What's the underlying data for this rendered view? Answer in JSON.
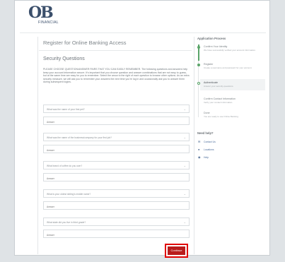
{
  "brand": {
    "logo_mark": "OB",
    "logo_sub": "FINANCIAL"
  },
  "page": {
    "title": "Register for Online Banking Access"
  },
  "section": {
    "heading": "Security Questions",
    "instructions": "PLEASE CHOOSE QUESTION/ANSWER PAIRS THAT YOU CAN EASILY REMEMBER. The following questions and answers help keep your account information secure. It's important that you choose question and answer combinations that are not easy to guess, but at the same time are easy for you to remember. Select the arrow to the right of each question to browse other options. As an extra security measure, we will ask you to remember your answers the next time you're log in and occasionally ask you to answer them during subsequent logins."
  },
  "questions": [
    {
      "question": "What was the name of your first pet?",
      "placeholder": "Answer"
    },
    {
      "question": "What was the name of the business/company for your first job?",
      "placeholder": "Answer"
    },
    {
      "question": "What brand of coffee do you own?",
      "placeholder": "Answer"
    },
    {
      "question": "What is your oldest sibling's middle name?",
      "placeholder": "Answer"
    },
    {
      "question": "What state did you live in third grade?",
      "placeholder": "Answer"
    }
  ],
  "continue_label": "Continue",
  "sidebar": {
    "title": "Application Process",
    "steps": [
      {
        "title": "Confirm Your Identity",
        "desc": "We have successfully verified your account information."
      },
      {
        "title": "Register",
        "desc": "Create a username and password for your account."
      },
      {
        "title": "Authenticate",
        "desc": "Answer your security questions."
      },
      {
        "title": "Confirm Contact Information",
        "desc": "Verify your contact information."
      },
      {
        "title": "Done",
        "desc": "You are ready to use Online Banking."
      }
    ],
    "help_title": "Need help?",
    "help_links": [
      "Contact Us",
      "Locations",
      "Help"
    ]
  },
  "colors": {
    "accent_green": "#5aa469",
    "continue_red": "#b91c1c",
    "highlight_box": "#e10000"
  }
}
